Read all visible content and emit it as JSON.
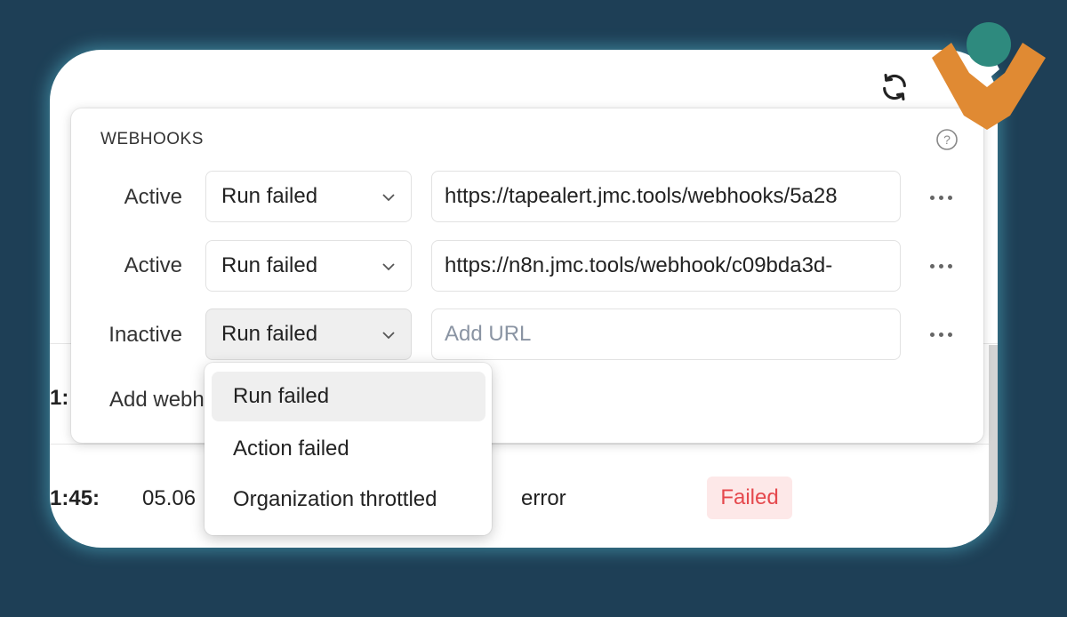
{
  "background_table": {
    "row1_time": "1:",
    "row2_time": "1:45:",
    "row2_date": "05.06",
    "row2_type": "error",
    "row2_status": "Failed"
  },
  "toolbar": {
    "refresh_icon": "refresh-icon"
  },
  "webhooks": {
    "title": "WEBHOOKS",
    "help_icon": "help-icon",
    "rows": [
      {
        "status": "Active",
        "event": "Run failed",
        "url": "https://tapealert.jmc.tools/webhooks/5a28",
        "placeholder": ""
      },
      {
        "status": "Active",
        "event": "Run failed",
        "url": "https://n8n.jmc.tools/webhook/c09bda3d-",
        "placeholder": ""
      },
      {
        "status": "Inactive",
        "event": "Run failed",
        "url": "",
        "placeholder": "Add URL"
      }
    ],
    "add_label": "Add webhook"
  },
  "dropdown": {
    "options": [
      "Run failed",
      "Action failed",
      "Organization throttled"
    ],
    "selected": "Run failed"
  },
  "colors": {
    "page_bg": "#1e3f56",
    "failed_text": "#e5484d",
    "failed_bg": "#fde8e8",
    "logo_orange": "#e08a33",
    "logo_teal": "#2e8a7e"
  }
}
